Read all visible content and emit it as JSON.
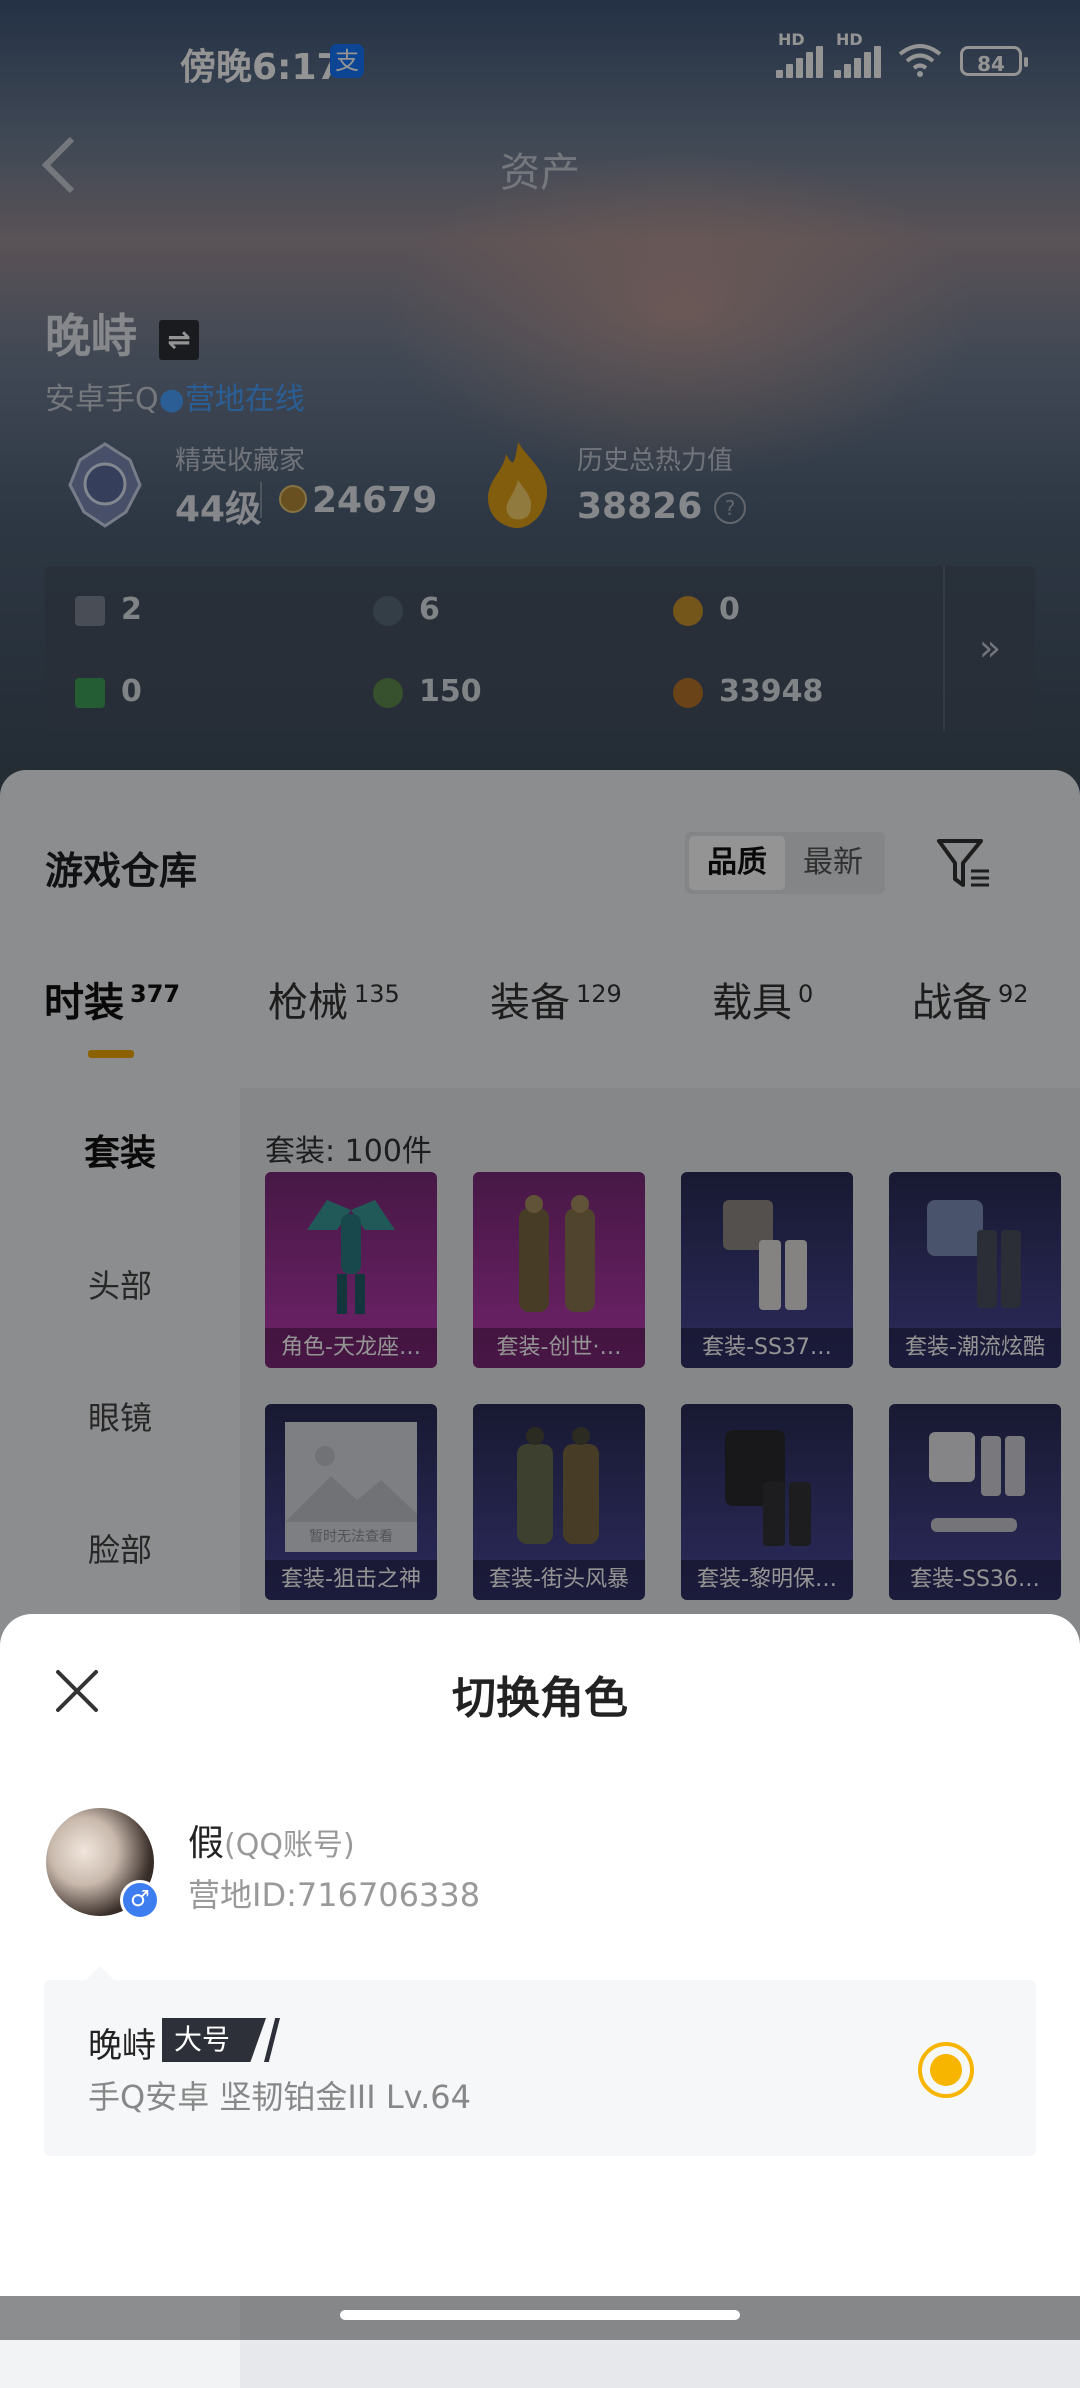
{
  "status_bar": {
    "time": "傍晚6:17",
    "app_icon": "支",
    "sig1": "HD",
    "sig2": "HD",
    "battery": "84"
  },
  "header": {
    "title": "资产",
    "back_icon": "chevron-left-icon"
  },
  "player": {
    "name": "晚峙",
    "switch_icon": "⇌",
    "platform": "安卓手Q",
    "online_dot": "●",
    "online_status": "营地在线"
  },
  "stats": {
    "collector_title": "精英收藏家",
    "level": "44级",
    "score": "24679",
    "heat_label": "历史总热力值",
    "heat_value": "38826",
    "help": "?"
  },
  "currencies": [
    {
      "value": "2",
      "color": "#7d8694"
    },
    {
      "value": "6",
      "color": "#5b6b7a"
    },
    {
      "value": "0",
      "color": "#c9932e"
    },
    {
      "value": "0",
      "color": "#3fa05b"
    },
    {
      "value": "150",
      "color": "#5f8a4e"
    },
    {
      "value": "33948",
      "color": "#b8742c"
    }
  ],
  "currency_more": "»",
  "warehouse": {
    "title": "游戏仓库",
    "sort_options": [
      "品质",
      "最新"
    ],
    "tabs": [
      {
        "label": "时装",
        "count": "377"
      },
      {
        "label": "枪械",
        "count": "135"
      },
      {
        "label": "装备",
        "count": "129"
      },
      {
        "label": "载具",
        "count": "0"
      },
      {
        "label": "战备",
        "count": "92"
      }
    ],
    "side": [
      "套装",
      "头部",
      "眼镜",
      "脸部"
    ],
    "content_label": "套装: 100件",
    "items": [
      "角色-天龙座…",
      "套装-创世·…",
      "套装-SS37…",
      "套装-潮流炫酷",
      "套装-狙击之神",
      "套装-街头风暴",
      "套装-黎明保…",
      "套装-SS36…"
    ],
    "placeholder_text": "暂时无法查看"
  },
  "sheet": {
    "title": "切换角色",
    "account_name": "假",
    "account_type": "(QQ账号)",
    "account_id": "营地ID:716706338",
    "gender": "♂",
    "role": {
      "name": "晚峙",
      "tag": "大号",
      "detail": "手Q安卓  坚韧铂金III  Lv.64",
      "selected": true
    }
  },
  "colors": {
    "accent": "#f7b500",
    "online": "#4aa3ff",
    "item_pink": "#c23cb9",
    "item_blue": "#4c4aa0"
  }
}
